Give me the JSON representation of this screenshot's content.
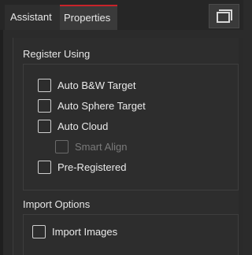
{
  "tabs": [
    {
      "label": "Assistant",
      "active": false
    },
    {
      "label": "Properties",
      "active": true
    }
  ],
  "colors": {
    "active_tab_accent": "#c8232a"
  },
  "register_using": {
    "title": "Register Using",
    "options": [
      {
        "label": "Auto B&W Target",
        "checked": false,
        "enabled": true
      },
      {
        "label": "Auto Sphere Target",
        "checked": false,
        "enabled": true
      },
      {
        "label": "Auto Cloud",
        "checked": false,
        "enabled": true
      },
      {
        "label": "Smart Align",
        "checked": false,
        "enabled": false
      },
      {
        "label": "Pre-Registered",
        "checked": false,
        "enabled": true
      }
    ]
  },
  "import_options": {
    "title": "Import Options",
    "options": [
      {
        "label": "Import Images",
        "checked": false,
        "enabled": true
      }
    ]
  },
  "icons": {
    "window_toggle": "restore-window-icon"
  }
}
